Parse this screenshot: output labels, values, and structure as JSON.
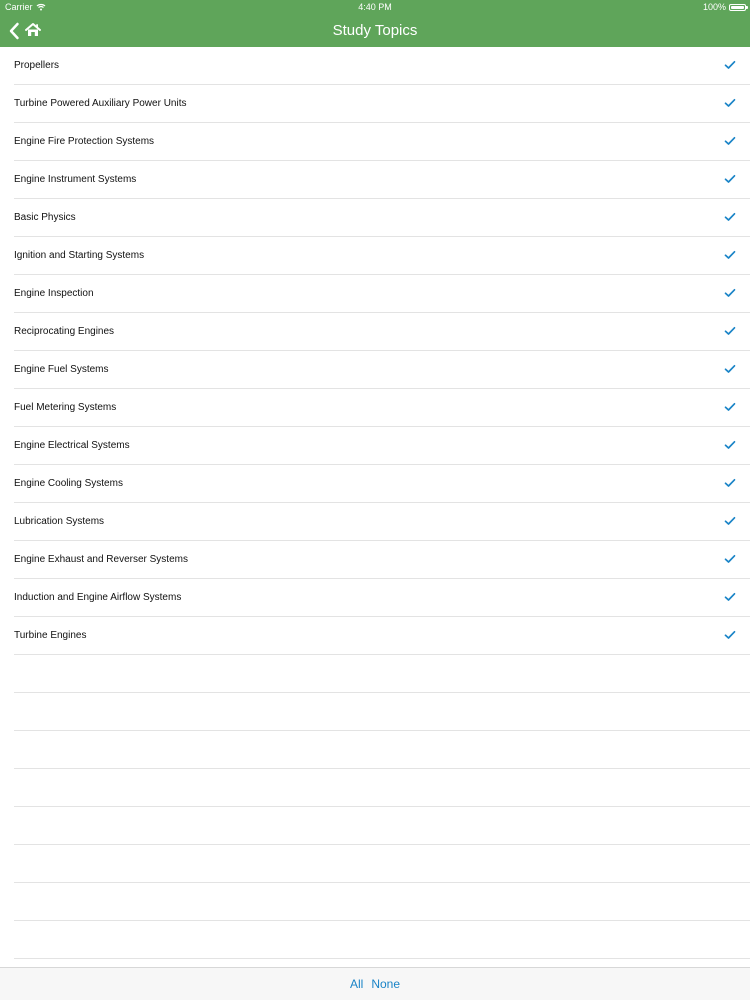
{
  "status_bar": {
    "carrier": "Carrier",
    "time": "4:40 PM",
    "battery_text": "100%",
    "battery_level": 1.0
  },
  "nav": {
    "title": "Study Topics",
    "back_icon": "chevron-left-icon",
    "home_icon": "home-icon"
  },
  "topics": [
    {
      "label": "Propellers",
      "checked": true
    },
    {
      "label": "Turbine Powered Auxiliary Power Units",
      "checked": true
    },
    {
      "label": "Engine Fire Protection Systems",
      "checked": true
    },
    {
      "label": "Engine Instrument Systems",
      "checked": true
    },
    {
      "label": "Basic Physics",
      "checked": true
    },
    {
      "label": "Ignition and Starting Systems",
      "checked": true
    },
    {
      "label": "Engine Inspection",
      "checked": true
    },
    {
      "label": "Reciprocating Engines",
      "checked": true
    },
    {
      "label": "Engine Fuel Systems",
      "checked": true
    },
    {
      "label": "Fuel Metering Systems",
      "checked": true
    },
    {
      "label": "Engine Electrical Systems",
      "checked": true
    },
    {
      "label": "Engine Cooling Systems",
      "checked": true
    },
    {
      "label": "Lubrication Systems",
      "checked": true
    },
    {
      "label": "Engine Exhaust and Reverser Systems",
      "checked": true
    },
    {
      "label": "Induction and Engine Airflow Systems",
      "checked": true
    },
    {
      "label": "Turbine Engines",
      "checked": true
    }
  ],
  "toolbar": {
    "all_label": "All",
    "none_label": "None"
  },
  "colors": {
    "header_green": "#5fa55a",
    "check_blue": "#1a84c7",
    "link_blue": "#1a84c7",
    "separator": "#e3e3e3"
  }
}
